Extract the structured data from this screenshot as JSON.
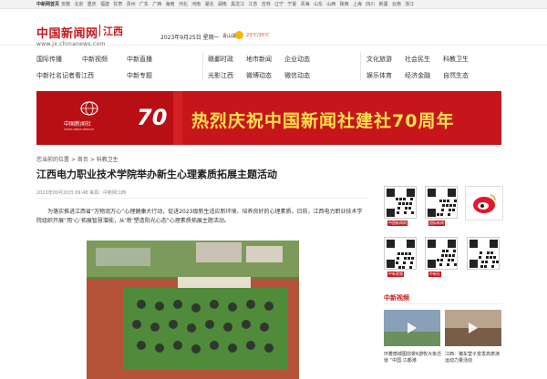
{
  "topbar": {
    "home_label": "中新网首页",
    "regions": [
      "安徽",
      "北京",
      "重庆",
      "福建",
      "甘肃",
      "贵州",
      "广东",
      "广西",
      "海南",
      "河北",
      "河南",
      "湖北",
      "湖南",
      "黑龙江",
      "江苏",
      "吉林",
      "辽宁",
      "宁夏",
      "青海",
      "山东",
      "山西",
      "陕西",
      "上海",
      "四川",
      "新疆",
      "云南",
      "浙江"
    ]
  },
  "header": {
    "logo_text": "中国新闻网",
    "region_text": "江西",
    "url_text": "www.jx.chinanews.com",
    "date_text": "2023年9月25日  星期一",
    "weather_city": "青山湖",
    "weather_temp": "23℃/35℃"
  },
  "nav": {
    "col1_row1": [
      "国际传播",
      "中新视频",
      "中新直播"
    ],
    "col1_row2": [
      "中新社名记者看江西",
      "中新专题"
    ],
    "col2_row1": [
      "赣鄱时政",
      "地市新闻",
      "企业动态"
    ],
    "col2_row2": [
      "光影江西",
      "微博动态",
      "微信动态"
    ],
    "col3_row1": [
      "文化旅游",
      "社会民生",
      "科教卫生"
    ],
    "col3_row2": [
      "娱乐体育",
      "经济金融",
      "自然生态"
    ]
  },
  "banner": {
    "cns_logo": "中国新闻社",
    "cns_en": "CHINA NEWS SERVICE",
    "anniversary": "70",
    "headline": "热烈庆祝中国新闻社建社70周年",
    "colors": {
      "bg": "#c7161b",
      "headline": "#ffe14d"
    }
  },
  "breadcrumb": {
    "label": "您当前的位置",
    "home": "首页",
    "section": "科教卫生"
  },
  "article": {
    "title": "江西电力职业技术学院举办新生心理素质拓展主题活动",
    "meta": "2023年09月20日 09:48   来源：中新网江西",
    "paragraph": "为落实推进江西省“万物润万心”心理健康大行动，促进2023级新生适应新环境、培养良好的心理素质。日前，江西电力职业技术学院组织开展“用‘心’拓展智慧潜能，从‘新’塑造阳光心态”心理素质拓展主题活动。"
  },
  "sidebar": {
    "qr_captions": [
      "中国新闻网",
      "国际新闻",
      "中新视频",
      "中新社"
    ],
    "weibo_label": "weibo"
  },
  "video": {
    "section_title": "中新视频",
    "items": [
      {
        "caption": "环着丽城图前景6游牧大象迁徙 “中国·江都港"
      },
      {
        "caption": "江西：猪车营子变发高表演 运动力量活动"
      }
    ]
  }
}
